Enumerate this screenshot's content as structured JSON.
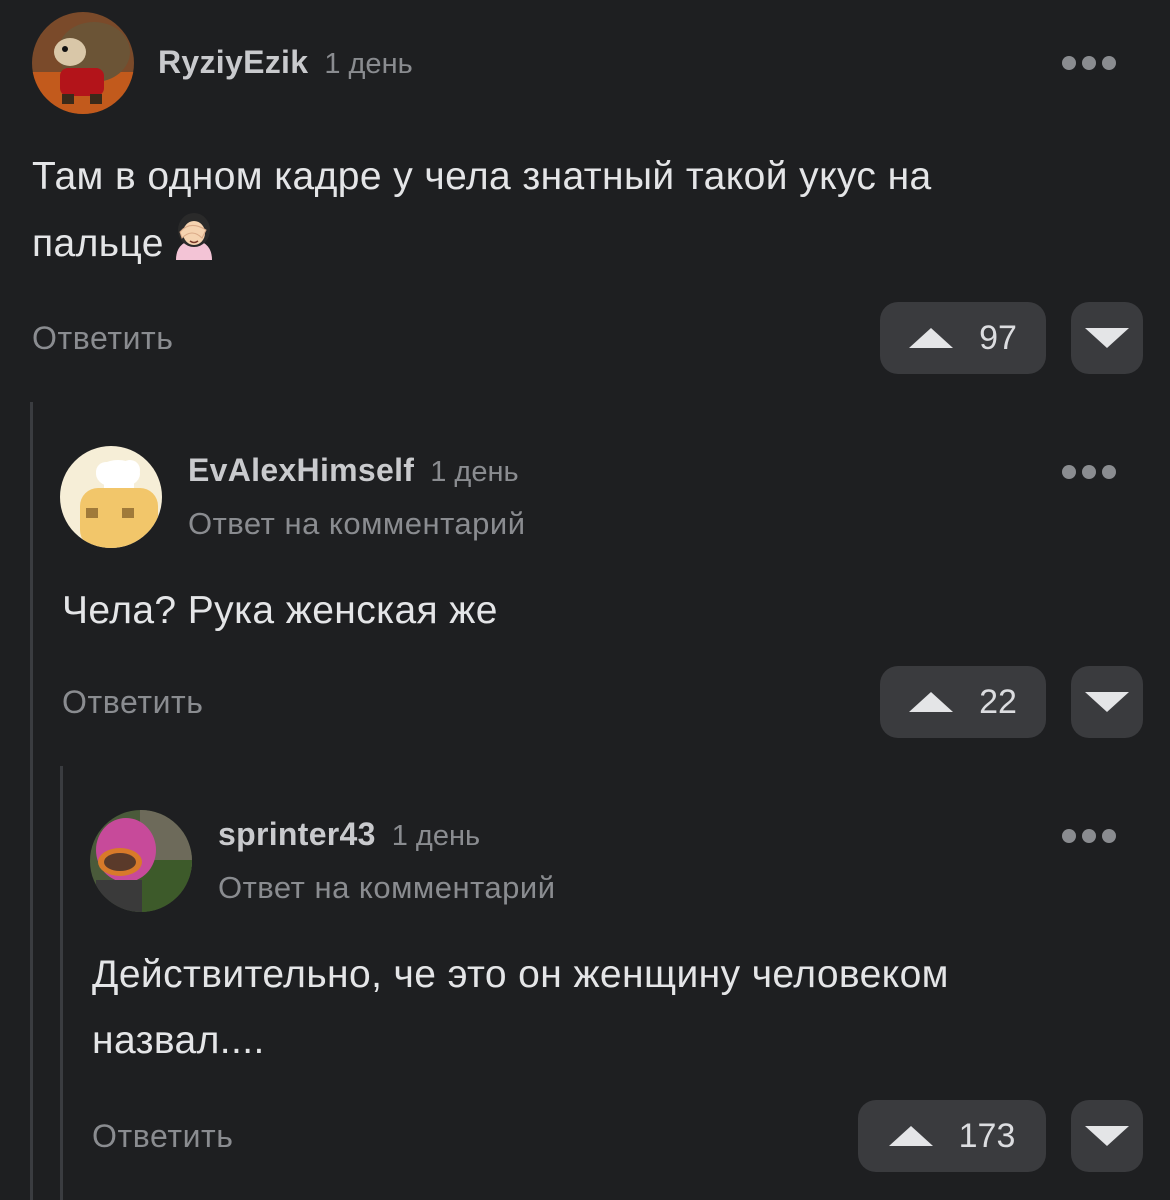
{
  "comments": [
    {
      "username": "RyziyEzik",
      "time": "1 день",
      "subline": "",
      "text_lines": [
        "Там в одном кадре у чела знатный такой укус на",
        "пальце"
      ],
      "emoji_icon": "woman-facepalming-icon",
      "reply_label": "Ответить",
      "votes": "97"
    },
    {
      "username": "EvAlexHimself",
      "time": "1 день",
      "subline": "Ответ на комментарий",
      "text_lines": [
        "Чела? Рука женская же"
      ],
      "reply_label": "Ответить",
      "votes": "22"
    },
    {
      "username": "sprinter43",
      "time": "1 день",
      "subline": "Ответ на комментарий",
      "text_lines": [
        "Действительно, че это он женщину человеком",
        "назвал...."
      ],
      "reply_label": "Ответить",
      "votes": "173"
    }
  ],
  "icons": {
    "more": "more-dots-icon",
    "upvote": "upvote-arrow-icon",
    "downvote": "downvote-arrow-icon"
  },
  "colors": {
    "background": "#1e1f21",
    "button": "#3a3b3e",
    "muted_text": "#8a8c90",
    "primary_text": "#e4e5e7"
  }
}
